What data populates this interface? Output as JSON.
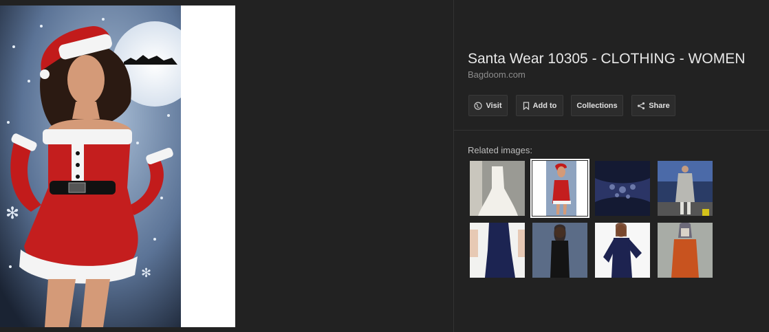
{
  "result": {
    "title": "Santa Wear 10305 - CLOTHING - WOMEN",
    "source": "Bagdoom.com"
  },
  "actions": {
    "visit_label": "Visit",
    "add_to_label": "Add to",
    "collections_label": "Collections",
    "share_label": "Share"
  },
  "related": {
    "label": "Related images:",
    "selected_index": 1
  },
  "colors": {
    "background": "#222222",
    "button_bg": "#2c2c2c",
    "title": "#e8e8e8"
  }
}
